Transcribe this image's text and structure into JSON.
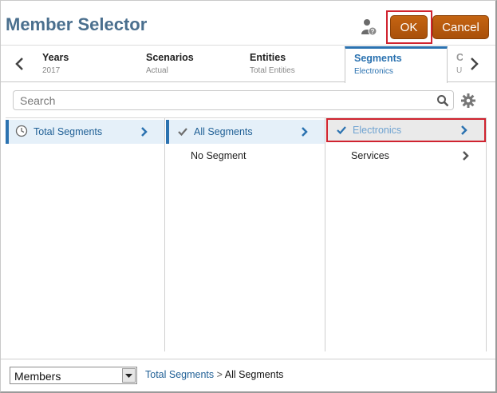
{
  "dialog": {
    "title": "Member Selector",
    "ok_label": "OK",
    "cancel_label": "Cancel"
  },
  "tabs": [
    {
      "name": "Years",
      "value": "2017"
    },
    {
      "name": "Scenarios",
      "value": "Actual"
    },
    {
      "name": "Entities",
      "value": "Total Entities"
    },
    {
      "name": "Segments",
      "value": "Electronics"
    },
    {
      "name": "C",
      "value": "U"
    }
  ],
  "search": {
    "placeholder": "Search"
  },
  "columns": {
    "col1": [
      {
        "label": "Total Segments"
      }
    ],
    "col2": [
      {
        "label": "All Segments"
      },
      {
        "label": "No Segment"
      }
    ],
    "col3": [
      {
        "label": "Electronics"
      },
      {
        "label": "Services"
      }
    ]
  },
  "footer": {
    "view_select": "Members",
    "breadcrumb": {
      "link": "Total Segments",
      "separator": ">",
      "current": "All Segments"
    }
  },
  "colors": {
    "accent": "#2b72b0",
    "button": "#b8580d",
    "highlight": "#d0232f"
  }
}
